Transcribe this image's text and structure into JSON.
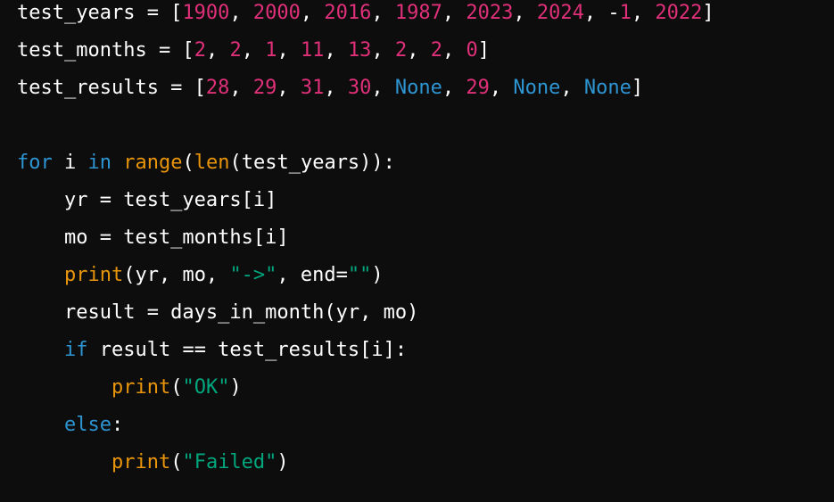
{
  "colors": {
    "background": "#0d0d0d",
    "plain": "#ffffff",
    "number": "#df3079",
    "keyword": "#2e95d3",
    "builtin_function": "#f22c3d",
    "call": "#e9950c",
    "string": "#00a67d",
    "constant": "#2e95d3"
  },
  "lines": [
    {
      "tokens": [
        {
          "type": "plain",
          "text": "test_years = ["
        },
        {
          "type": "num",
          "text": "1900"
        },
        {
          "type": "plain",
          "text": ", "
        },
        {
          "type": "num",
          "text": "2000"
        },
        {
          "type": "plain",
          "text": ", "
        },
        {
          "type": "num",
          "text": "2016"
        },
        {
          "type": "plain",
          "text": ", "
        },
        {
          "type": "num",
          "text": "1987"
        },
        {
          "type": "plain",
          "text": ", "
        },
        {
          "type": "num",
          "text": "2023"
        },
        {
          "type": "plain",
          "text": ", "
        },
        {
          "type": "num",
          "text": "2024"
        },
        {
          "type": "plain",
          "text": ", -"
        },
        {
          "type": "num",
          "text": "1"
        },
        {
          "type": "plain",
          "text": ", "
        },
        {
          "type": "num",
          "text": "2022"
        },
        {
          "type": "plain",
          "text": "]"
        }
      ]
    },
    {
      "tokens": [
        {
          "type": "plain",
          "text": "test_months = ["
        },
        {
          "type": "num",
          "text": "2"
        },
        {
          "type": "plain",
          "text": ", "
        },
        {
          "type": "num",
          "text": "2"
        },
        {
          "type": "plain",
          "text": ", "
        },
        {
          "type": "num",
          "text": "1"
        },
        {
          "type": "plain",
          "text": ", "
        },
        {
          "type": "num",
          "text": "11"
        },
        {
          "type": "plain",
          "text": ", "
        },
        {
          "type": "num",
          "text": "13"
        },
        {
          "type": "plain",
          "text": ", "
        },
        {
          "type": "num",
          "text": "2"
        },
        {
          "type": "plain",
          "text": ", "
        },
        {
          "type": "num",
          "text": "2"
        },
        {
          "type": "plain",
          "text": ", "
        },
        {
          "type": "num",
          "text": "0"
        },
        {
          "type": "plain",
          "text": "]"
        }
      ]
    },
    {
      "tokens": [
        {
          "type": "plain",
          "text": "test_results = ["
        },
        {
          "type": "num",
          "text": "28"
        },
        {
          "type": "plain",
          "text": ", "
        },
        {
          "type": "num",
          "text": "29"
        },
        {
          "type": "plain",
          "text": ", "
        },
        {
          "type": "num",
          "text": "31"
        },
        {
          "type": "plain",
          "text": ", "
        },
        {
          "type": "num",
          "text": "30"
        },
        {
          "type": "plain",
          "text": ", "
        },
        {
          "type": "const",
          "text": "None"
        },
        {
          "type": "plain",
          "text": ", "
        },
        {
          "type": "num",
          "text": "29"
        },
        {
          "type": "plain",
          "text": ", "
        },
        {
          "type": "const",
          "text": "None"
        },
        {
          "type": "plain",
          "text": ", "
        },
        {
          "type": "const",
          "text": "None"
        },
        {
          "type": "plain",
          "text": "]"
        }
      ]
    },
    {
      "tokens": []
    },
    {
      "tokens": [
        {
          "type": "kw",
          "text": "for"
        },
        {
          "type": "plain",
          "text": " i "
        },
        {
          "type": "kw",
          "text": "in"
        },
        {
          "type": "plain",
          "text": " "
        },
        {
          "type": "call",
          "text": "range"
        },
        {
          "type": "plain",
          "text": "("
        },
        {
          "type": "call",
          "text": "len"
        },
        {
          "type": "plain",
          "text": "(test_years)):"
        }
      ]
    },
    {
      "tokens": [
        {
          "type": "plain",
          "text": "    yr = test_years[i]"
        }
      ]
    },
    {
      "tokens": [
        {
          "type": "plain",
          "text": "    mo = test_months[i]"
        }
      ]
    },
    {
      "tokens": [
        {
          "type": "plain",
          "text": "    "
        },
        {
          "type": "call",
          "text": "print"
        },
        {
          "type": "plain",
          "text": "(yr, mo, "
        },
        {
          "type": "str",
          "text": "\"->\""
        },
        {
          "type": "plain",
          "text": ", end="
        },
        {
          "type": "str",
          "text": "\"\""
        },
        {
          "type": "plain",
          "text": ")"
        }
      ]
    },
    {
      "tokens": [
        {
          "type": "plain",
          "text": "    result = days_in_month(yr, mo)"
        }
      ]
    },
    {
      "tokens": [
        {
          "type": "plain",
          "text": "    "
        },
        {
          "type": "kw",
          "text": "if"
        },
        {
          "type": "plain",
          "text": " result == test_results[i]:"
        }
      ]
    },
    {
      "tokens": [
        {
          "type": "plain",
          "text": "        "
        },
        {
          "type": "call",
          "text": "print"
        },
        {
          "type": "plain",
          "text": "("
        },
        {
          "type": "str",
          "text": "\"OK\""
        },
        {
          "type": "plain",
          "text": ")"
        }
      ]
    },
    {
      "tokens": [
        {
          "type": "plain",
          "text": "    "
        },
        {
          "type": "kw",
          "text": "else"
        },
        {
          "type": "plain",
          "text": ":"
        }
      ]
    },
    {
      "tokens": [
        {
          "type": "plain",
          "text": "        "
        },
        {
          "type": "call",
          "text": "print"
        },
        {
          "type": "plain",
          "text": "("
        },
        {
          "type": "str",
          "text": "\"Failed\""
        },
        {
          "type": "plain",
          "text": ")"
        }
      ]
    }
  ]
}
